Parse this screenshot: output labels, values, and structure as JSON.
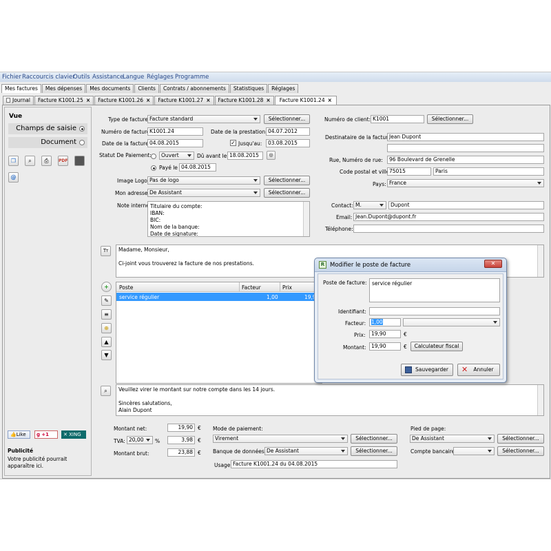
{
  "menu": [
    "Fichier",
    "Raccourcis clavier",
    "Outils",
    "Assistance",
    "Langue",
    "Réglages",
    "Programme"
  ],
  "main_tabs": [
    {
      "label": "Mes factures",
      "active": true
    },
    {
      "label": "Mes dépenses",
      "active": false
    },
    {
      "label": "Mes documents",
      "active": false
    },
    {
      "label": "Clients",
      "active": false
    },
    {
      "label": "Contrats / abonnements",
      "active": false
    },
    {
      "label": "Statistiques",
      "active": false
    },
    {
      "label": "Réglages",
      "active": false
    }
  ],
  "doc_tabs": [
    {
      "label": "Journal",
      "active": false,
      "closable": false
    },
    {
      "label": "Facture K1001.25",
      "active": false,
      "closable": true
    },
    {
      "label": "Facture K1001.26",
      "active": false,
      "closable": true
    },
    {
      "label": "Facture K1001.27",
      "active": false,
      "closable": true
    },
    {
      "label": "Facture K1001.28",
      "active": false,
      "closable": true
    },
    {
      "label": "Facture K1001.24",
      "active": true,
      "closable": true
    }
  ],
  "sidebar": {
    "vue_label": "Vue",
    "option_champs": "Champs de saisie",
    "option_document": "Document",
    "like_label": "Like",
    "gplus_label": "+1",
    "xing_label": "XING",
    "pub_title": "Publicité",
    "pub_text": "Votre publicité pourrait apparaître ici."
  },
  "form": {
    "type_label": "Type de facture:",
    "type_value": "Facture standard",
    "numero_label": "Numéro de facture:",
    "numero_value": "K1001.24",
    "date_prestation_label": "Date de la prestation:",
    "date_prestation_value": "04.07.2012",
    "date_facture_label": "Date de la facture:",
    "date_facture_value": "04.08.2015",
    "jusqu_label": "Jusqu'au:",
    "jusqu_value": "03.08.2015",
    "statut_label": "Statut De Paiement:",
    "statut_value": "Ouvert",
    "du_avant_label": "Dû avant le",
    "du_avant_value": "18.08.2015",
    "paye_label": "Payé le",
    "paye_value": "04.08.2015",
    "logo_label": "Image Logo:",
    "logo_value": "Pas de logo",
    "adresse_label": "Mon adresse:",
    "adresse_value": "De Assistant",
    "note_label": "Note interne:",
    "note_value": "Titulaire du compte:\nIBAN:\nBIC:\nNom de la banque:\nDate de signature:",
    "select_label": "Sélectionner..."
  },
  "client": {
    "numero_label": "Numéro de client:",
    "numero_value": "K1001",
    "dest_label": "Destinataire de la facture:",
    "dest_value": "Jean Dupont",
    "rue_label": "Rue, Numéro de rue:",
    "rue_value": "96 Boulevard de Grenelle",
    "cp_label": "Code postal et ville:",
    "cp_value": "75015",
    "ville_value": "Paris",
    "pays_label": "Pays:",
    "pays_value": "France",
    "contact_label": "Contact:",
    "civilite_value": "M.",
    "contact_value": "Dupont",
    "email_label": "Email:",
    "email_value": "Jean.Dupont@dupont.fr",
    "tel_label": "Téléphone:",
    "tel_value": ""
  },
  "intro_text": "Madame, Monsieur,\n\nCi-joint vous trouverez la facture de nos prestations.",
  "items_table": {
    "headers": [
      "Poste",
      "Facteur",
      "Prix"
    ],
    "rows": [
      {
        "poste": "service régulier",
        "facteur": "1,00",
        "prix": "19,90"
      }
    ]
  },
  "closing_text": "Veuillez virer le montant sur notre compte dans les 14 jours.\n\nSincères salutations,\nAlain Dupont",
  "totals": {
    "net_label": "Montant net:",
    "net_value": "19,90",
    "tva_label": "TVA:",
    "tva_rate": "20,00",
    "tva_value": "3,98",
    "brut_label": "Montant brut:",
    "brut_value": "23,88",
    "currency": "€",
    "percent": "%"
  },
  "payment": {
    "mode_label": "Mode de paiement:",
    "mode_value": "Virement",
    "banque_label": "Banque de données:",
    "banque_value": "De Assistant",
    "usage_label": "Usage:",
    "usage_value": "Facture K1001.24 du 04.08.2015",
    "pied_label": "Pied de page:",
    "pied_value": "De Assistant",
    "compte_label": "Compte bancaire:",
    "compte_value": ""
  },
  "dialog": {
    "title": "Modifier le poste de facture",
    "poste_label": "Poste de facture:",
    "poste_value": "service régulier",
    "ident_label": "Identifiant:",
    "ident_value": "",
    "facteur_label": "Facteur:",
    "facteur_value": "1,00",
    "prix_label": "Prix:",
    "prix_value": "19,90",
    "montant_label": "Montant:",
    "montant_value": "19,90",
    "currency": "€",
    "calc_label": "Calculateur fiscal",
    "save_label": "Sauvegarder",
    "cancel_label": "Annuler"
  },
  "colors": {
    "accent": "#3399ff",
    "close_button": "#c9423a"
  }
}
